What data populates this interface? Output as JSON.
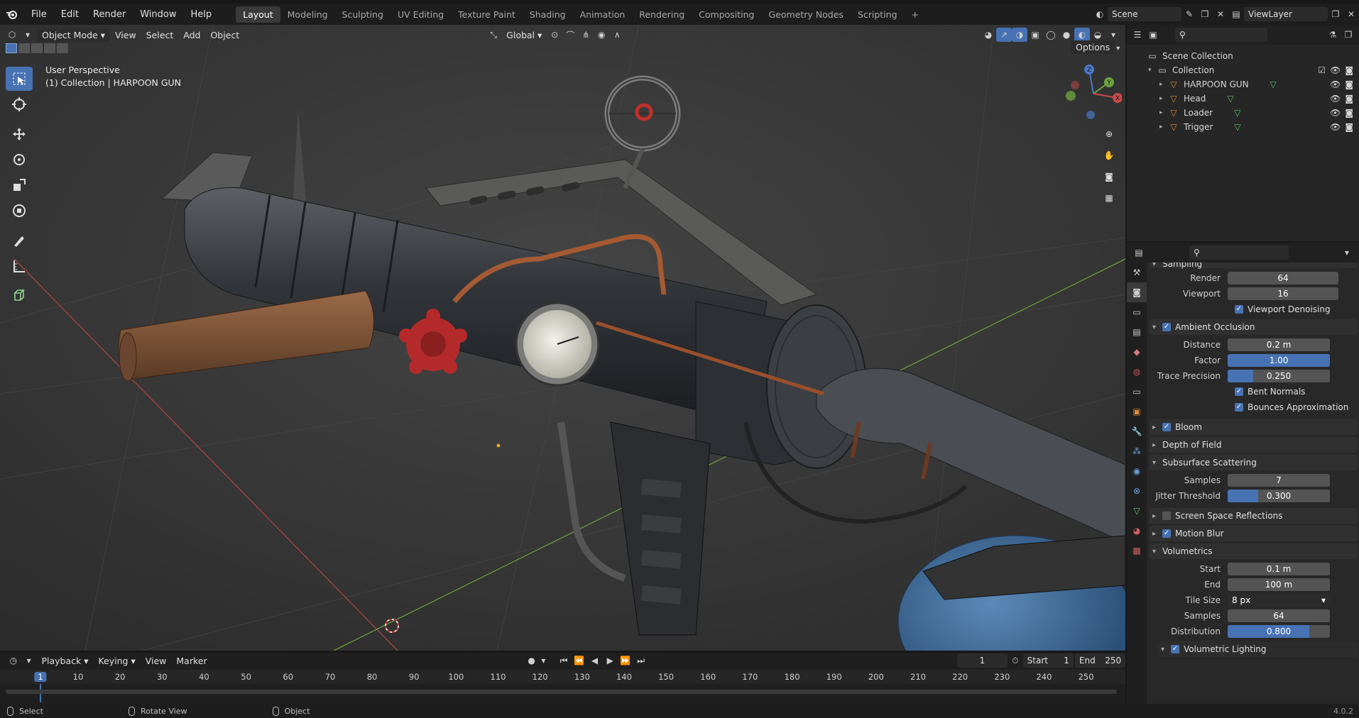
{
  "topbar": {
    "menus": [
      "File",
      "Edit",
      "Render",
      "Window",
      "Help"
    ],
    "workspaces": [
      "Layout",
      "Modeling",
      "Sculpting",
      "UV Editing",
      "Texture Paint",
      "Shading",
      "Animation",
      "Rendering",
      "Compositing",
      "Geometry Nodes",
      "Scripting"
    ],
    "active_workspace": "Layout",
    "add_tab": "+",
    "scene_name": "Scene",
    "view_layer": "ViewLayer"
  },
  "viewport": {
    "mode": "Object Mode",
    "menus": [
      "View",
      "Select",
      "Add",
      "Object"
    ],
    "orientation": "Global",
    "options_label": "Options",
    "perspective_label": "User Perspective",
    "collection_label": "(1) Collection | HARPOON GUN",
    "gizmo_axes": [
      "Z",
      "Y",
      "X"
    ]
  },
  "outliner": {
    "search_placeholder": "",
    "scene_collection": "Scene Collection",
    "collection": "Collection",
    "objects": [
      "HARPOON GUN",
      "Head",
      "Loader",
      "Trigger"
    ]
  },
  "properties": {
    "search_placeholder": "",
    "sampling": {
      "title": "Sampling",
      "render_label": "Render",
      "render": "64",
      "viewport_label": "Viewport",
      "viewport": "16",
      "denoise_label": "Viewport Denoising"
    },
    "ao": {
      "title": "Ambient Occlusion",
      "distance_label": "Distance",
      "distance": "0.2 m",
      "factor_label": "Factor",
      "factor": "1.00",
      "factor_fill": 1.0,
      "trace_label": "Trace Precision",
      "trace": "0.250",
      "trace_fill": 0.25,
      "bent_label": "Bent Normals",
      "bounces_label": "Bounces Approximation"
    },
    "bloom": "Bloom",
    "dof": "Depth of Field",
    "sss": {
      "title": "Subsurface Scattering",
      "samples_label": "Samples",
      "samples": "7",
      "jitter_label": "Jitter Threshold",
      "jitter": "0.300",
      "jitter_fill": 0.3
    },
    "ssr": "Screen Space Reflections",
    "motion_blur": "Motion Blur",
    "volumetrics": {
      "title": "Volumetrics",
      "start_label": "Start",
      "start": "0.1 m",
      "end_label": "End",
      "end": "100 m",
      "tile_label": "Tile Size",
      "tile": "8 px",
      "samples_label": "Samples",
      "samples": "64",
      "dist_label": "Distribution",
      "dist": "0.800",
      "dist_fill": 0.8,
      "lighting_label": "Volumetric Lighting"
    }
  },
  "timeline": {
    "menus": [
      "Playback",
      "Keying",
      "View",
      "Marker"
    ],
    "current_frame": "1",
    "start_label": "Start",
    "start": "1",
    "end_label": "End",
    "end": "250",
    "ruler": [
      "1",
      "10",
      "20",
      "30",
      "40",
      "50",
      "60",
      "70",
      "80",
      "90",
      "100",
      "110",
      "120",
      "130",
      "140",
      "150",
      "160",
      "170",
      "180",
      "190",
      "200",
      "210",
      "220",
      "230",
      "240",
      "250"
    ]
  },
  "status": {
    "select": "Select",
    "rotate": "Rotate View",
    "object": "Object",
    "version": "4.0.2"
  },
  "colors": {
    "accent": "#4772b3",
    "bg": "#181818",
    "viewport": "#3c3c3c",
    "panel": "#282828"
  }
}
